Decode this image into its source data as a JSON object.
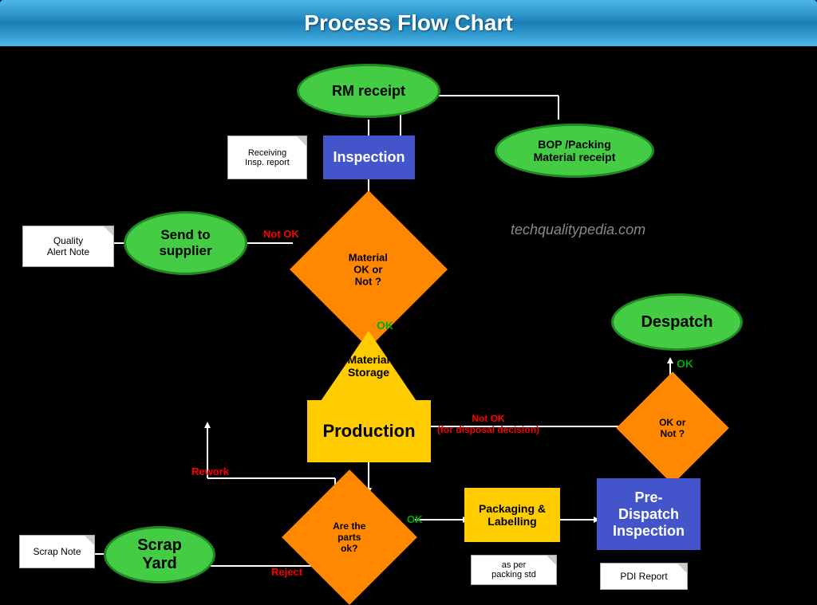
{
  "title": "Process Flow Chart",
  "watermark": "techqualitypedia.com",
  "nodes": {
    "rm_receipt": "RM receipt",
    "inspection": "Inspection",
    "receiving_report": "Receiving\nInsp. report",
    "bop_packing": "BOP /Packing\nMaterial receipt",
    "material_ok": "Material\nOK or\nNot ?",
    "send_to_supplier": "Send to\nsupplier",
    "quality_alert": "Quality\nAlert Note",
    "material_storage": "Material\nStorage",
    "production": "Production",
    "are_parts_ok": "Are the\nparts\nok?",
    "packaging": "Packaging &\nLabelling",
    "as_per_packing": "as per\npacking std",
    "pre_dispatch": "Pre-\nDispatch\nInspection",
    "pdi_report": "PDI Report",
    "ok_or_not": "OK or\nNot ?",
    "despatch": "Despatch",
    "scrap_yard": "Scrap\nYard",
    "scrap_note": "Scrap Note"
  },
  "labels": {
    "not_ok": "Not OK",
    "ok": "OK",
    "rework": "Rework",
    "reject": "Reject",
    "not_ok_disposal": "Not OK\n(for disposal decision)",
    "ok_despatch": "OK"
  },
  "colors": {
    "header_bg": "#2196a8",
    "green_ellipse": "#44cc44",
    "blue_rect": "#4444cc",
    "orange_diamond": "#ff8800",
    "yellow_triangle": "#ffcc00",
    "yellow_rect": "#ffcc00",
    "blue_rect2": "#4444cc",
    "white": "#ffffff",
    "red_label": "#ff0000",
    "green_label": "#00aa00",
    "black": "#000000"
  }
}
